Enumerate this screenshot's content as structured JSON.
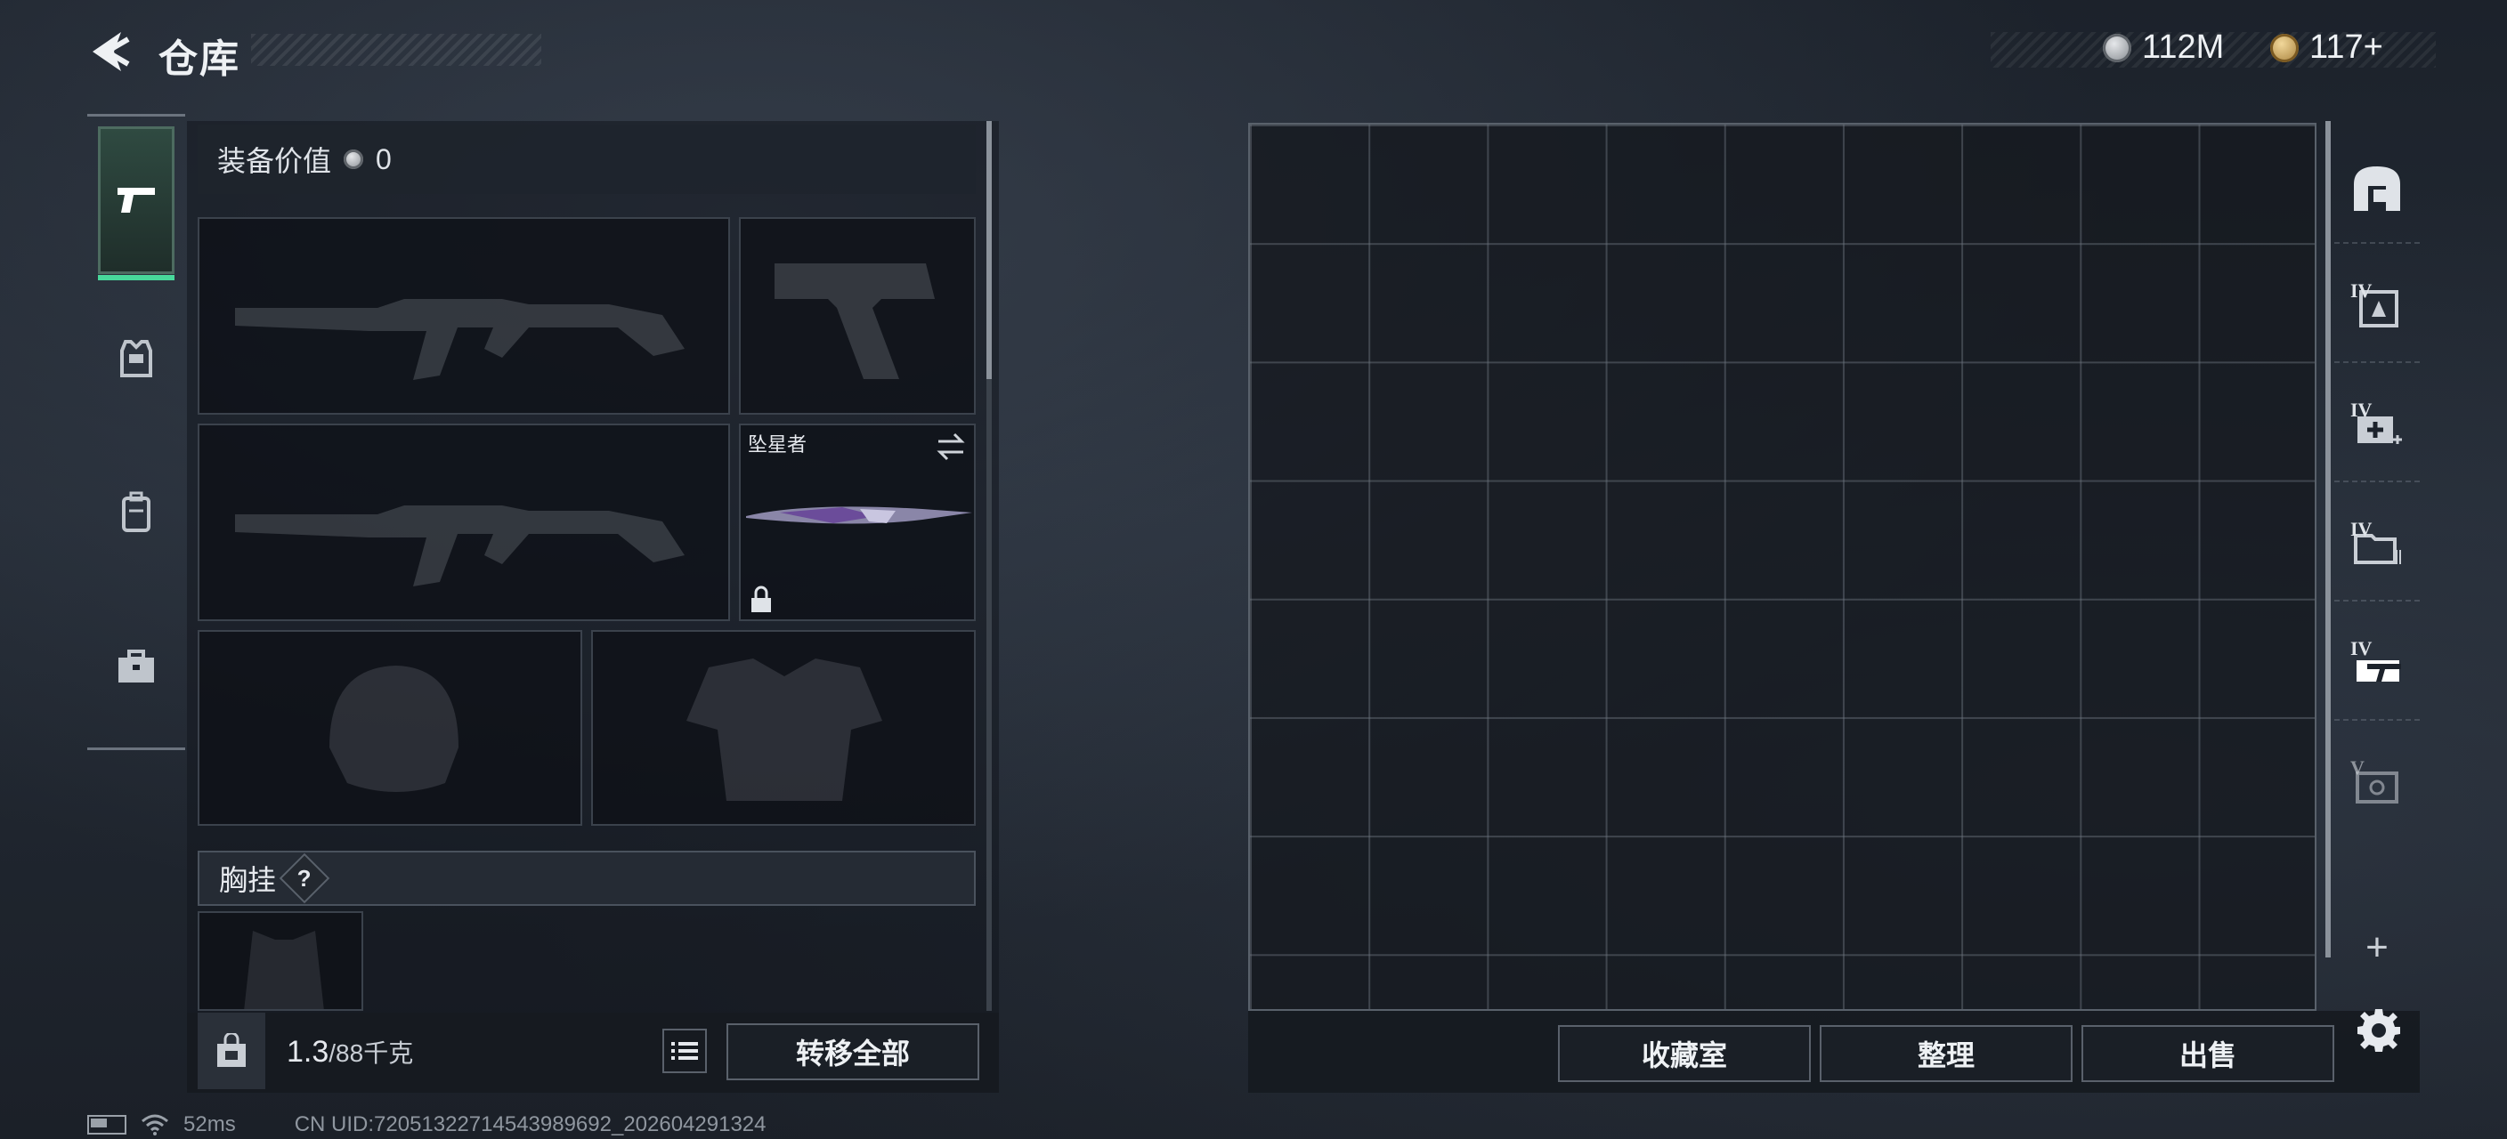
{
  "header": {
    "back_icon": "back-arrow-icon",
    "title": "仓库",
    "currencies": [
      {
        "icon": "silver-coin-icon",
        "value": "112M"
      },
      {
        "icon": "gold-coin-icon",
        "value": "117+"
      }
    ]
  },
  "rail": {
    "items": [
      {
        "icon": "pistol-icon",
        "active": true
      },
      {
        "icon": "armor-vest-icon",
        "active": false
      },
      {
        "icon": "backpack-icon",
        "active": false
      },
      {
        "icon": "briefcase-icon",
        "active": false
      }
    ]
  },
  "loadout": {
    "value_label": "装备价值",
    "value": "0",
    "slots": {
      "primary_1": {
        "icon": "rifle-placeholder-icon"
      },
      "secondary": {
        "icon": "pistol-placeholder-icon"
      },
      "primary_2": {
        "icon": "rifle-placeholder-icon"
      },
      "melee": {
        "name": "坠星者",
        "icon": "knife-icon",
        "swap_icon": "swap-arrows-icon",
        "lock_icon": "lock-icon"
      },
      "helmet": {
        "icon": "helmet-placeholder-icon"
      },
      "armor": {
        "icon": "armor-placeholder-icon"
      }
    },
    "vest_label": "胸挂",
    "vest_help": "?"
  },
  "weight": {
    "current": "1.3",
    "capacity": "/88千克",
    "transfer_all": "转移全部"
  },
  "storage": {
    "buttons": {
      "collection": "收藏室",
      "organize": "整理",
      "sell": "出售"
    },
    "tabs": [
      {
        "icon": "vault-icon",
        "tier": ""
      },
      {
        "icon": "ammo-crate-icon",
        "tier": "IV"
      },
      {
        "icon": "medical-crate-icon",
        "tier": "IV"
      },
      {
        "icon": "folder-crate-icon",
        "tier": "IV"
      },
      {
        "icon": "weapon-crate-icon",
        "tier": "IV"
      },
      {
        "icon": "gear-crate-icon",
        "tier": "V"
      }
    ],
    "add_tab": "+"
  },
  "status": {
    "ping": "52ms",
    "uid": "CN UID:72051322714543989692_202604291324"
  },
  "colors": {
    "accent": "#48d99b",
    "panel": "#12161d",
    "border": "#3b424c"
  }
}
